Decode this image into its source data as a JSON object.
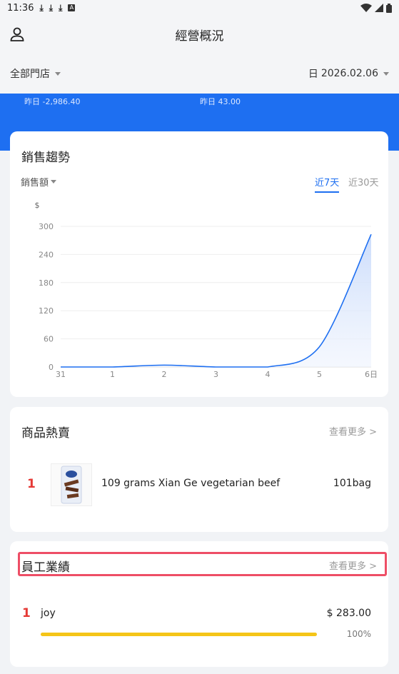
{
  "status_bar": {
    "time": "11:36",
    "left_icons": [
      "download-icon",
      "download-icon",
      "download-icon",
      "a-notification-icon"
    ],
    "right_icons": [
      "wifi-icon",
      "signal-icon",
      "battery-icon"
    ]
  },
  "header": {
    "title": "經營概況",
    "left_icon": "user-icon"
  },
  "filters": {
    "store_label": "全部門店",
    "date_prefix": "日",
    "date_value": "2026.02.06"
  },
  "summary": {
    "left_yesterday": "昨日 -2,986.40",
    "right_yesterday": "昨日 43.00"
  },
  "sales_trend": {
    "title": "銷售趨勢",
    "metric_label": "銷售額",
    "tabs": [
      {
        "label": "近7天",
        "active": true
      },
      {
        "label": "近30天",
        "active": false
      }
    ]
  },
  "chart_data": {
    "type": "area",
    "ylabel": "$",
    "ylim": [
      0,
      300
    ],
    "yticks": [
      0,
      60,
      120,
      180,
      240,
      300
    ],
    "categories": [
      "31",
      "1",
      "2",
      "3",
      "4",
      "5",
      "6日"
    ],
    "series": [
      {
        "values": [
          0,
          0,
          4,
          0,
          0,
          43,
          283
        ]
      }
    ],
    "grid": true,
    "line_color": "#1e6ff1",
    "fill_color": "#dde8fb"
  },
  "hot_products": {
    "title": "商品熱賣",
    "more_label": "查看更多 >",
    "items": [
      {
        "rank": "1",
        "name": "109 grams Xian Ge vegetarian beef",
        "qty": "101bag"
      }
    ]
  },
  "staff_performance": {
    "title": "員工業績",
    "more_label": "查看更多 >",
    "items": [
      {
        "rank": "1",
        "name": "joy",
        "amount": "$ 283.00",
        "percent": "100%",
        "progress": 1.0
      }
    ]
  },
  "colors": {
    "primary": "#1e6ff1",
    "rank": "#e53935",
    "progress": "#f5c518",
    "highlight": "#ee4e66"
  }
}
